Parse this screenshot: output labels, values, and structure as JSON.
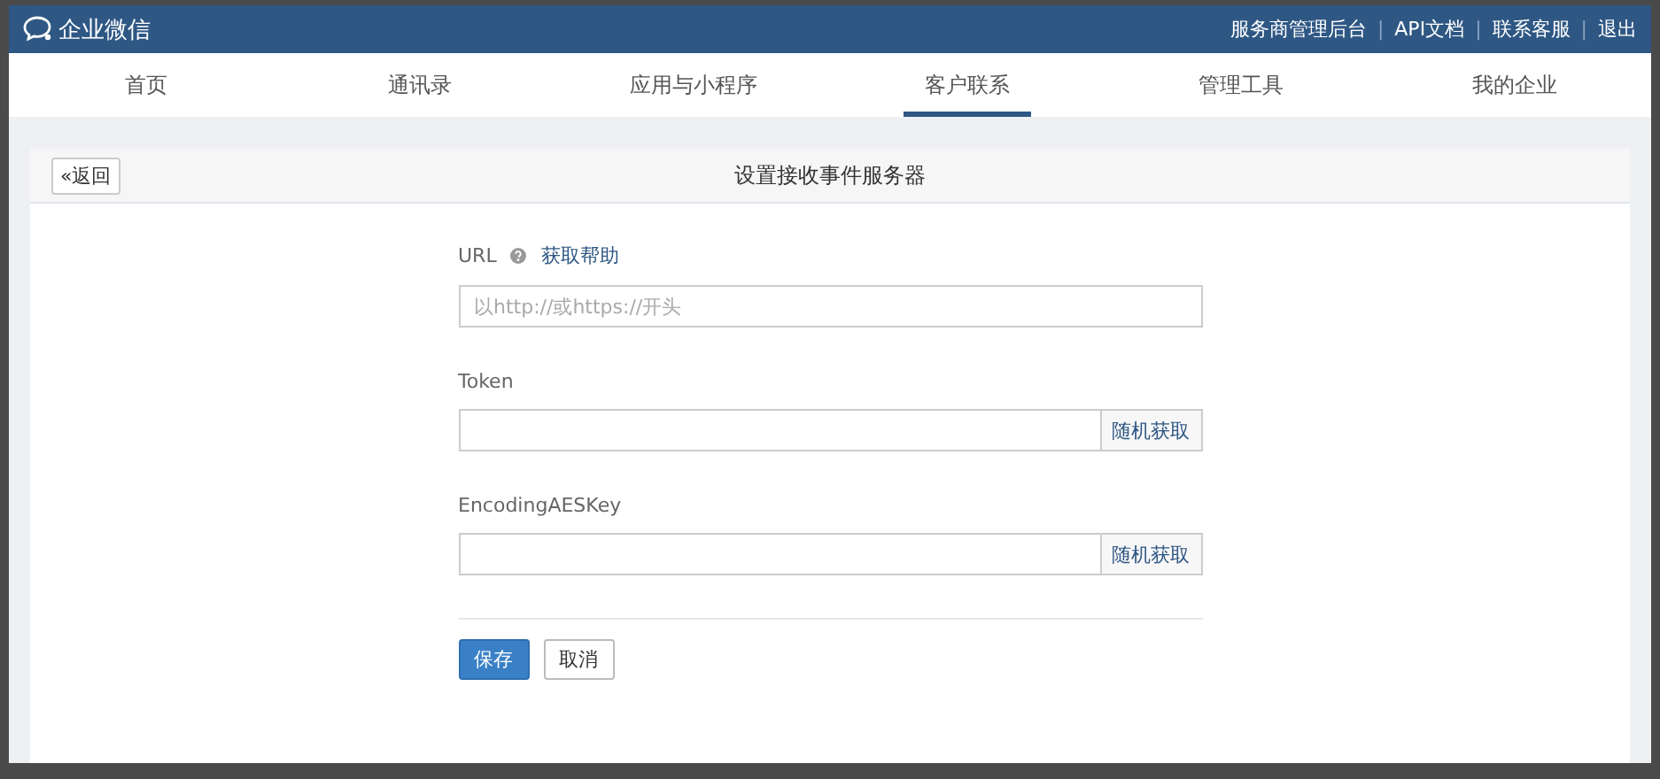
{
  "header": {
    "brand": "企业微信",
    "links": [
      "服务商管理后台",
      "API文档",
      "联系客服",
      "退出"
    ],
    "separator": "|"
  },
  "nav": [
    {
      "label": "首页",
      "selected": false
    },
    {
      "label": "通讯录",
      "selected": false
    },
    {
      "label": "应用与小程序",
      "selected": false
    },
    {
      "label": "客户联系",
      "selected": true
    },
    {
      "label": "管理工具",
      "selected": false
    },
    {
      "label": "我的企业",
      "selected": false
    }
  ],
  "panel": {
    "back": "«返回",
    "title": "设置接收事件服务器"
  },
  "form": {
    "fields": [
      {
        "label": "URL",
        "kind": "help",
        "help_link": "获取帮助",
        "placeholder": "以http://或https://开头"
      },
      {
        "label": "Token",
        "kind": "random",
        "action": "随机获取"
      },
      {
        "label": "EncodingAESKey",
        "kind": "random",
        "action": "随机获取"
      }
    ],
    "save": "保存",
    "cancel": "取消"
  }
}
